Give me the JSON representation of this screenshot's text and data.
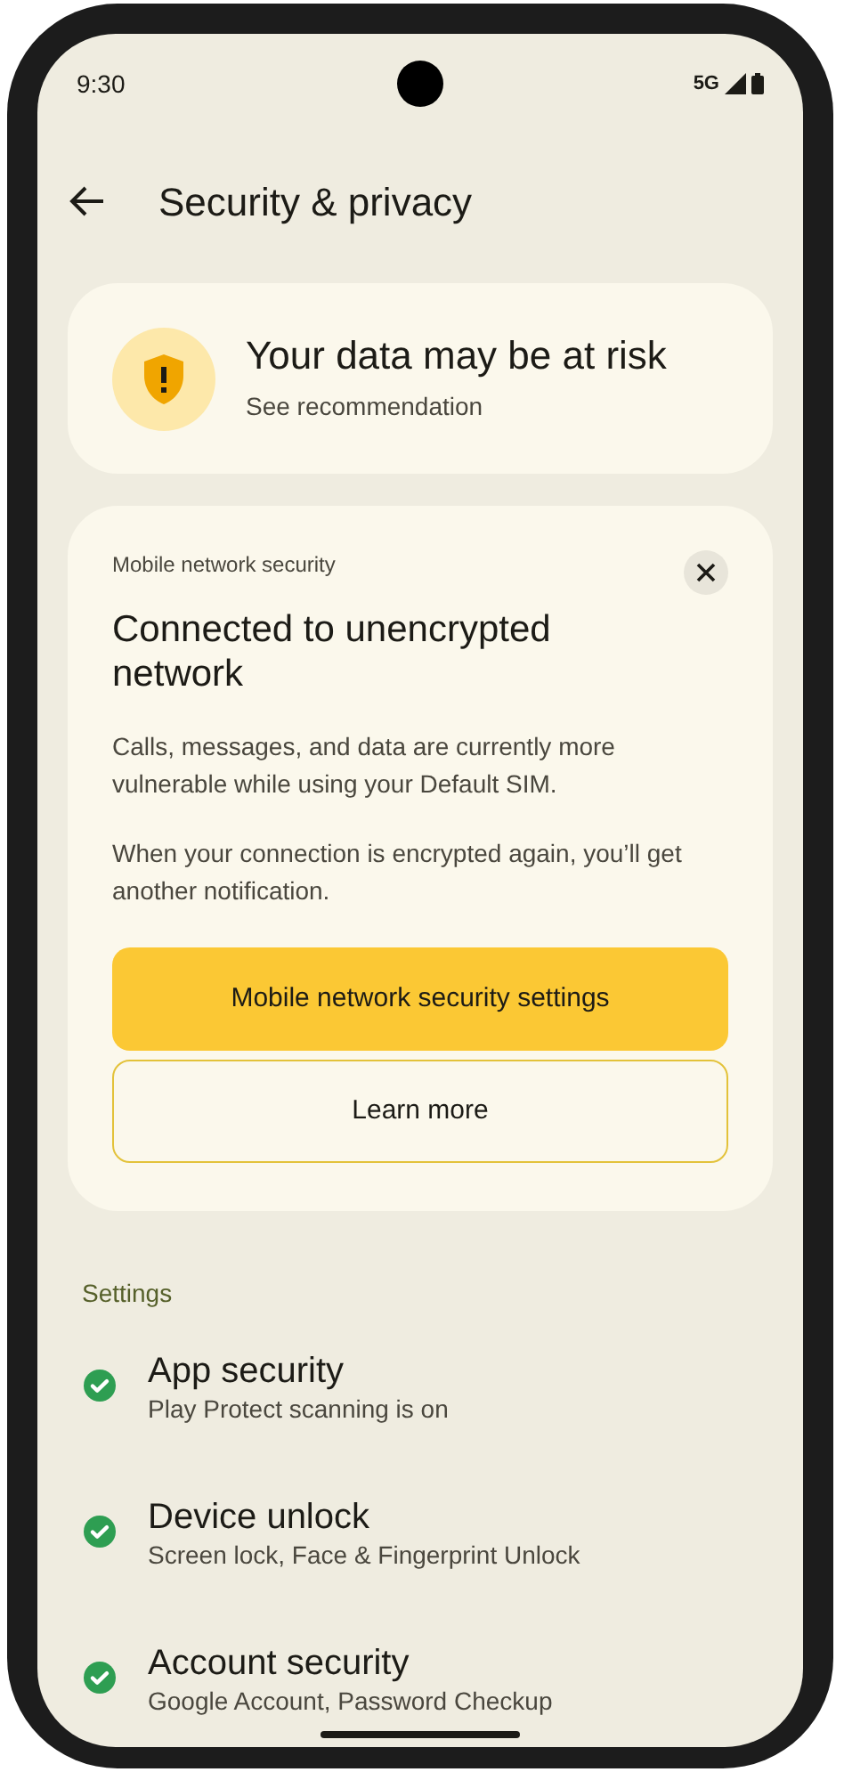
{
  "status_bar": {
    "time": "9:30",
    "network": "5G"
  },
  "app_bar": {
    "title": "Security & privacy"
  },
  "risk_card": {
    "title": "Your data may be at risk",
    "subtitle": "See recommendation"
  },
  "alert_card": {
    "category": "Mobile network security",
    "title": "Connected to unencrypted network",
    "paragraphs": [
      "Calls, messages, and data are currently more vulnerable while using your Default SIM.",
      "When your connection is encrypted again, you’ll get another notification."
    ],
    "buttons": [
      {
        "label": "Mobile network security settings",
        "kind": "filled"
      },
      {
        "label": "Learn more",
        "kind": "outlined"
      }
    ]
  },
  "settings": {
    "heading": "Settings",
    "items": [
      {
        "title": "App security",
        "subtitle": "Play Protect scanning is on",
        "secure": true
      },
      {
        "title": "Device unlock",
        "subtitle": "Screen lock, Face & Fingerprint Unlock",
        "secure": true
      },
      {
        "title": "Account security",
        "subtitle": "Google Account, Password Checkup",
        "secure": true
      }
    ]
  }
}
